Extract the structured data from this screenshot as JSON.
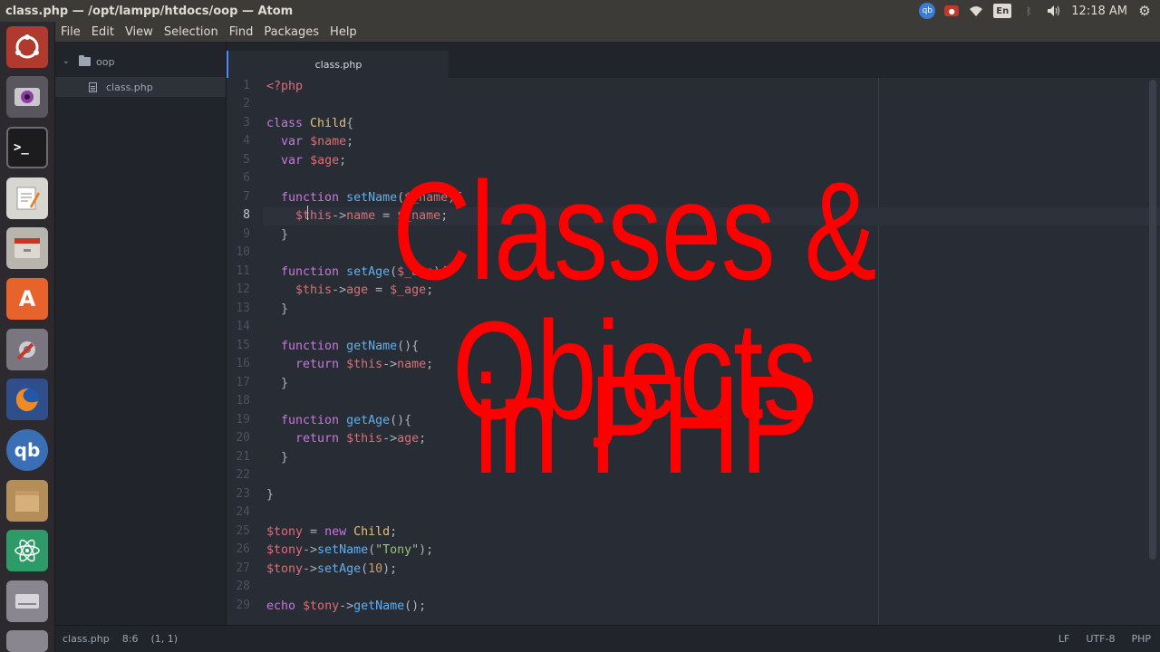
{
  "window": {
    "title": "class.php — /opt/lampp/htdocs/oop — Atom"
  },
  "tray": {
    "qbittorrent_label": "qb",
    "language": "En",
    "clock": "12:18 AM",
    "icons": [
      "qbittorrent-icon",
      "camera-icon",
      "wifi-icon",
      "language-icon",
      "bluetooth-icon",
      "volume-icon",
      "gear-icon"
    ]
  },
  "launcher": {
    "items": [
      "ubuntu-dash-icon",
      "webcam-icon",
      "terminal-icon",
      "text-editor-icon",
      "file-manager-icon",
      "software-center-icon",
      "system-settings-icon",
      "firefox-icon",
      "qbittorrent-icon",
      "archive-icon",
      "atom-icon",
      "disk-icon"
    ],
    "terminal_glyph": ">_",
    "qbittorrent_glyph": "qb",
    "software_glyph": "A"
  },
  "menubar": {
    "items": [
      "File",
      "Edit",
      "View",
      "Selection",
      "Find",
      "Packages",
      "Help"
    ]
  },
  "tree": {
    "folder": "oop",
    "files": [
      "class.php"
    ]
  },
  "tabs": [
    {
      "label": "class.php",
      "active": true
    }
  ],
  "editor": {
    "active_line": 8,
    "line_numbers": [
      "1",
      "2",
      "3",
      "4",
      "5",
      "6",
      "7",
      "8",
      "9",
      "10",
      "11",
      "12",
      "13",
      "14",
      "15",
      "16",
      "17",
      "18",
      "19",
      "20",
      "21",
      "22",
      "23",
      "24",
      "25",
      "26",
      "27",
      "28",
      "29"
    ],
    "lines": [
      "<?php",
      "",
      "class Child{",
      "  var $name;",
      "  var $age;",
      "",
      "  function setName($_name){",
      "    $this->name = $_name;",
      "  }",
      "",
      "  function setAge($_age){",
      "    $this->age = $_age;",
      "  }",
      "",
      "  function getName(){",
      "    return $this->name;",
      "  }",
      "",
      "  function getAge(){",
      "    return $this->age;",
      "  }",
      "",
      "}",
      "",
      "$tony = new Child;",
      "$tony->setName(\"Tony\");",
      "$tony->setAge(10);",
      "",
      "echo $tony->getName();"
    ]
  },
  "overlay": {
    "line1": "Classes & Objects",
    "line2": "in PHP",
    "color": "#ff0000"
  },
  "statusbar": {
    "file": "class.php",
    "position": "8:6",
    "selection": "(1, 1)",
    "line_ending": "LF",
    "encoding": "UTF-8",
    "grammar": "PHP"
  }
}
